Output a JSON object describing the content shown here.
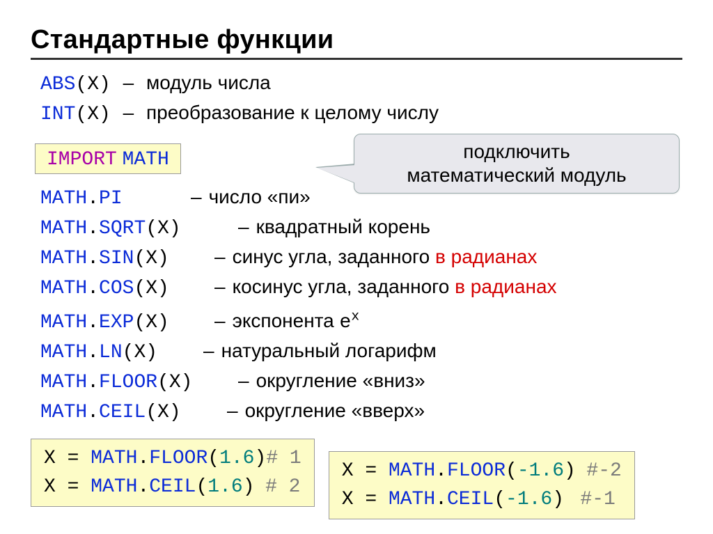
{
  "title": "Стандартные функции",
  "top_funcs": [
    {
      "func_html": "<span class='fn'>ABS</span><span class='mono'>(X)</span>",
      "desc": "модуль числа"
    },
    {
      "func_html": "<span class='fn'>INT</span><span class='mono'>(X)</span>",
      "desc": "преобразование к целому числу"
    }
  ],
  "import_stmt": "<span class='kw'>IMPORT</span> <span class='fn'>MATH</span>",
  "callout_line1": "подключить",
  "callout_line2": "математический модуль",
  "math_funcs": [
    {
      "func_html": "<span class='fn'>MATH</span><span class='mono'>.</span><span class='fn'>PI</span>",
      "desc_html": "число «пи»"
    },
    {
      "func_html": "<span class='fn'>MATH</span><span class='mono'>.</span><span class='fn'>SQRT</span><span class='mono'>(X)</span>",
      "desc_html": "квадратный корень"
    },
    {
      "func_html": "<span class='fn'>MATH</span><span class='mono'>.</span><span class='fn'>SIN</span><span class='mono'>(X)</span>",
      "desc_html": "синус угла, заданного <span class='red'>в радианах</span>"
    },
    {
      "func_html": "<span class='fn'>MATH</span><span class='mono'>.</span><span class='fn'>COS</span><span class='mono'>(X)</span>",
      "desc_html": "косинус угла, заданного <span class='red'>в радианах</span>"
    },
    {
      "func_html": "<span class='fn'>MATH</span><span class='mono'>.</span><span class='fn'>EXP</span><span class='mono'>(X)</span>",
      "desc_html": "экспонента <span class='mono'>e<sup>x</sup></span>"
    },
    {
      "func_html": "<span class='fn'>MATH</span><span class='mono'>.</span><span class='fn'>LN</span><span class='mono'>(X)</span>",
      "desc_html": "натуральный логарифм"
    },
    {
      "func_html": "<span class='fn'>MATH</span><span class='mono'>.</span><span class='fn'>FLOOR</span><span class='mono'>(X)</span>",
      "desc_html": "округление «вниз»"
    },
    {
      "func_html": "<span class='fn'>MATH</span><span class='mono'>.</span><span class='fn'>CEIL</span><span class='mono'>(X)</span>",
      "desc_html": "округление «вверх»"
    }
  ],
  "examples_left": [
    "<span class='mono'>X = </span><span class='fn'>MATH</span><span class='mono'>.</span><span class='fn'>FLOOR</span><span class='mono'>(</span><span class='lit'>1.6</span><span class='mono'>)</span><span class='cmt'># 1</span>",
    "<span class='mono'>X = </span><span class='fn'>MATH</span><span class='mono'>.</span><span class='fn'>CEIL</span><span class='mono'>(</span><span class='lit'>1.6</span><span class='mono'>)</span>&nbsp; <span class='cmt'># 2</span>"
  ],
  "examples_right": [
    "<span class='mono'>X = </span><span class='fn'>MATH</span><span class='mono'>.</span><span class='fn'>FLOOR</span><span class='mono'>(</span><span class='lit'>-1.6</span><span class='mono'>)</span>&nbsp; <span class='cmt'>#-2</span>",
    "<span class='mono'>X = </span><span class='fn'>MATH</span><span class='mono'>.</span><span class='fn'>CEIL</span><span class='mono'>(</span><span class='lit'>-1.6</span><span class='mono'>)</span>&nbsp;&nbsp; <span class='cmt'>#-1</span>"
  ]
}
